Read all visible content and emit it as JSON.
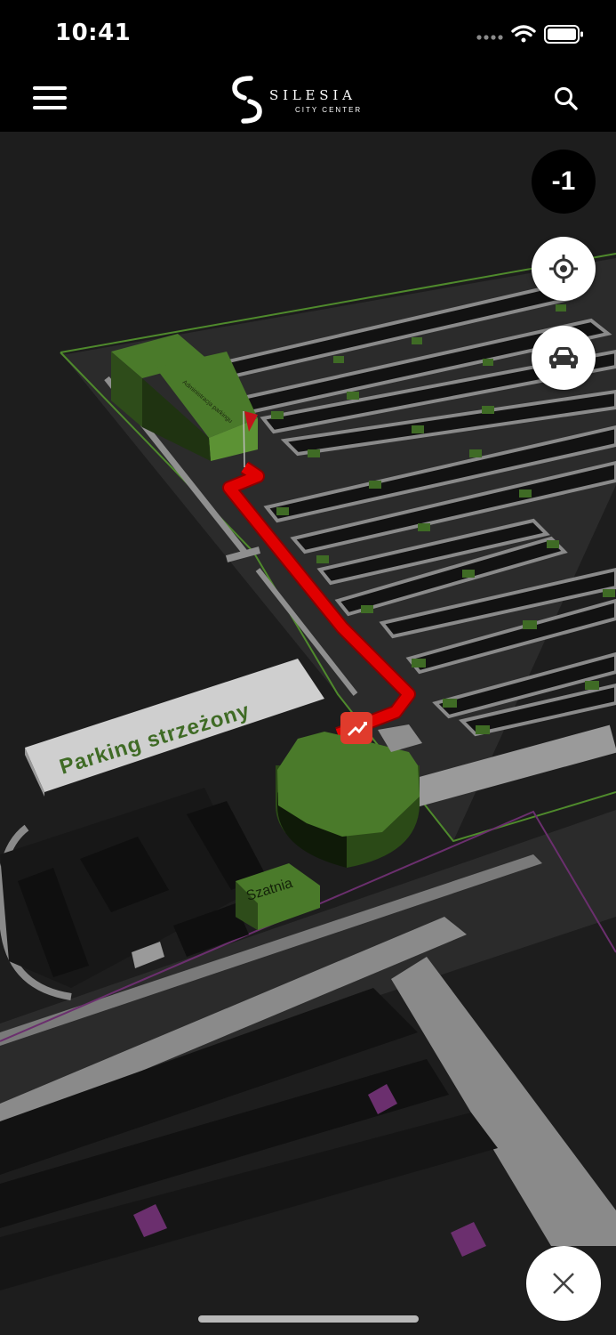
{
  "status": {
    "time": "10:41"
  },
  "header": {
    "brand_name": "SILESIA",
    "brand_subtitle": "CITY CENTER",
    "menu_icon": "hamburger-icon",
    "search_icon": "search-icon"
  },
  "map": {
    "labels": {
      "parking": "Parking strzeżony",
      "cloakroom": "Szatnia"
    },
    "colors": {
      "background": "#1d1d1d",
      "route": "#e00000",
      "spot_marker": "#3f6b25",
      "building_green": "#4a7a2a",
      "store_marker": "#6b2f6e"
    },
    "icons": {
      "destination": "flag-icon",
      "transfer": "escalator-icon"
    }
  },
  "controls": {
    "floor": "-1",
    "locate_icon": "crosshair-icon",
    "parking_icon": "car-icon",
    "close_icon": "close-icon"
  }
}
